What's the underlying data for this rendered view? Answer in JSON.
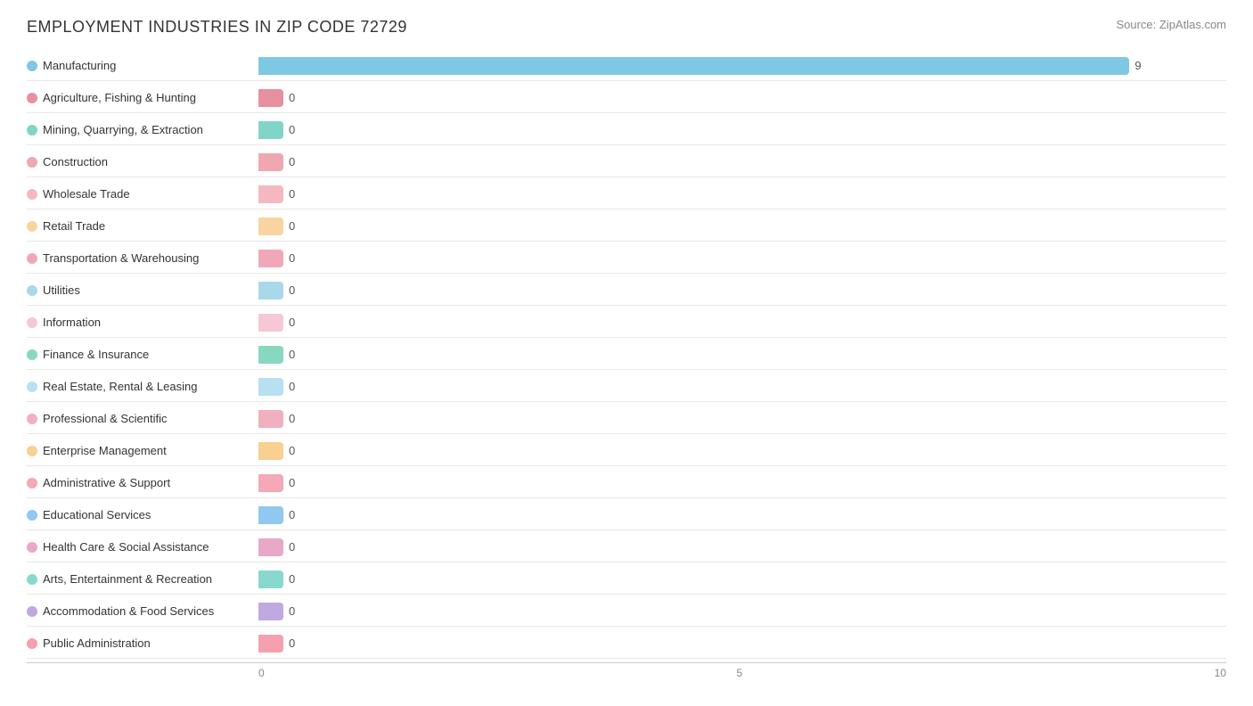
{
  "title": "EMPLOYMENT INDUSTRIES IN ZIP CODE 72729",
  "source": "Source: ZipAtlas.com",
  "chart": {
    "max_value": 10,
    "tick_values": [
      0,
      5,
      10
    ],
    "bars": [
      {
        "label": "Manufacturing",
        "value": 9,
        "color": "#7ec8e3",
        "dot_color": "#7ec8e3"
      },
      {
        "label": "Agriculture, Fishing & Hunting",
        "value": 0,
        "color": "#e88fa0",
        "dot_color": "#e88fa0"
      },
      {
        "label": "Mining, Quarrying, & Extraction",
        "value": 0,
        "color": "#81d4c8",
        "dot_color": "#81d4c8"
      },
      {
        "label": "Construction",
        "value": 0,
        "color": "#f0a8b0",
        "dot_color": "#f0a8b0"
      },
      {
        "label": "Wholesale Trade",
        "value": 0,
        "color": "#f4b8c0",
        "dot_color": "#f4b8c0"
      },
      {
        "label": "Retail Trade",
        "value": 0,
        "color": "#f9d4a0",
        "dot_color": "#f9d4a0"
      },
      {
        "label": "Transportation & Warehousing",
        "value": 0,
        "color": "#f0a8b8",
        "dot_color": "#f0a8b8"
      },
      {
        "label": "Utilities",
        "value": 0,
        "color": "#a8d8ea",
        "dot_color": "#a8d8ea"
      },
      {
        "label": "Information",
        "value": 0,
        "color": "#f4c8d4",
        "dot_color": "#f4c8d4"
      },
      {
        "label": "Finance & Insurance",
        "value": 0,
        "color": "#88d8c0",
        "dot_color": "#88d8c0"
      },
      {
        "label": "Real Estate, Rental & Leasing",
        "value": 0,
        "color": "#b8e0f0",
        "dot_color": "#b8e0f0"
      },
      {
        "label": "Professional & Scientific",
        "value": 0,
        "color": "#f0b0c0",
        "dot_color": "#f0b0c0"
      },
      {
        "label": "Enterprise Management",
        "value": 0,
        "color": "#f8d090",
        "dot_color": "#f8d090"
      },
      {
        "label": "Administrative & Support",
        "value": 0,
        "color": "#f4a8b8",
        "dot_color": "#f4a8b8"
      },
      {
        "label": "Educational Services",
        "value": 0,
        "color": "#90c8f0",
        "dot_color": "#90c8f0"
      },
      {
        "label": "Health Care & Social Assistance",
        "value": 0,
        "color": "#e8a8c8",
        "dot_color": "#e8a8c8"
      },
      {
        "label": "Arts, Entertainment & Recreation",
        "value": 0,
        "color": "#88d8d0",
        "dot_color": "#88d8d0"
      },
      {
        "label": "Accommodation & Food Services",
        "value": 0,
        "color": "#c0a8e0",
        "dot_color": "#c0a8e0"
      },
      {
        "label": "Public Administration",
        "value": 0,
        "color": "#f4a0b0",
        "dot_color": "#f4a0b0"
      }
    ]
  }
}
